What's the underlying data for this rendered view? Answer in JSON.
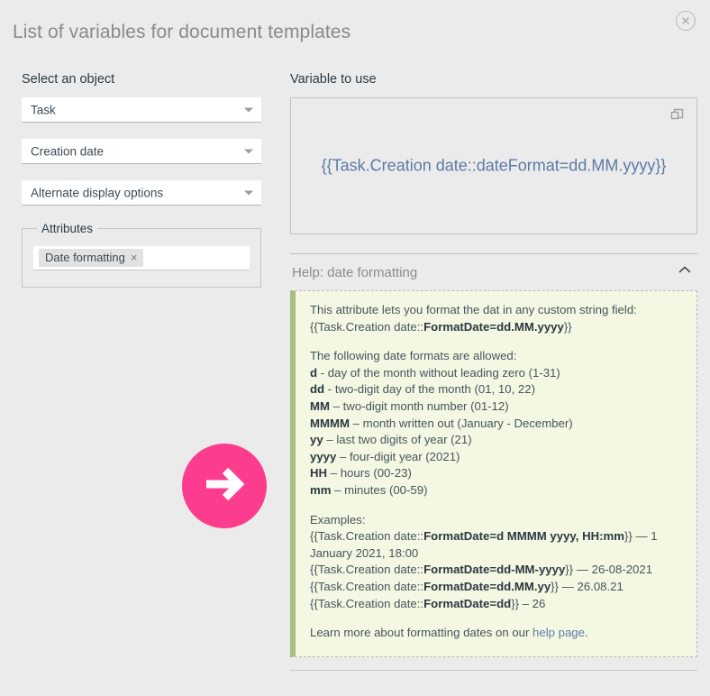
{
  "dialog": {
    "title": "List of variables for document templates",
    "close_icon": "close-circle-icon"
  },
  "left_panel": {
    "label": "Select an object",
    "selects": [
      {
        "name": "object-select",
        "value": "Task"
      },
      {
        "name": "field-select",
        "value": "Creation date"
      },
      {
        "name": "display-options-select",
        "value": "Alternate display options"
      }
    ],
    "attributes": {
      "legend": "Attributes",
      "chips": [
        {
          "label": "Date formatting",
          "remove_icon": "×"
        }
      ]
    }
  },
  "right_panel": {
    "label": "Variable to use",
    "variable": "{{Task.Creation date::dateFormat=dd.MM.yyyy}}",
    "copy_icon": "copy-icon",
    "help": {
      "title": "Help: date formatting",
      "collapse_icon": "chevron-up-icon",
      "intro_line1": "This attribute lets you format the dat in any custom string field:",
      "intro_line2_pre": "{{Task.Creation date::",
      "intro_line2_bold": "FormatDate=dd.MM.yyyy",
      "intro_line2_post": "}}",
      "formats_heading": "The following date formats are allowed:",
      "formats": [
        {
          "token": "d",
          "desc": " - day of the month without leading zero (1-31)"
        },
        {
          "token": "dd",
          "desc": " - two-digit day of the month (01, 10, 22)"
        },
        {
          "token": "MM",
          "desc": " – two-digit month number (01-12)"
        },
        {
          "token": "MMMM",
          "desc": " – month written out (January - December)"
        },
        {
          "token": "yy",
          "desc": " – last two digits of year (21)"
        },
        {
          "token": "yyyy",
          "desc": " – four-digit year (2021)"
        },
        {
          "token": "HH",
          "desc": " – hours (00-23)"
        },
        {
          "token": "mm",
          "desc": " – minutes (00-59)"
        }
      ],
      "examples_heading": "Examples:",
      "examples": [
        {
          "pre": "{{Task.Creation date::",
          "bold": "FormatDate=d MMMM yyyy, HH:mm",
          "post": "}} — 1 January 2021, 18:00"
        },
        {
          "pre": "{{Task.Creation date::",
          "bold": "FormatDate=dd-MM-yyyy",
          "post": "}} — 26-08-2021"
        },
        {
          "pre": "{{Task.Creation date::",
          "bold": "FormatDate=dd.MM.yy",
          "post": "}} — 26.08.21"
        },
        {
          "pre": "{{Task.Creation date::",
          "bold": "FormatDate=dd",
          "post": "}} – 26"
        }
      ],
      "footer_pre": "Learn more about formatting dates on our ",
      "footer_link": "help page",
      "footer_post": "."
    }
  },
  "annotation": {
    "arrow_icon": "arrow-right-icon",
    "color": "#fc3d8e"
  }
}
